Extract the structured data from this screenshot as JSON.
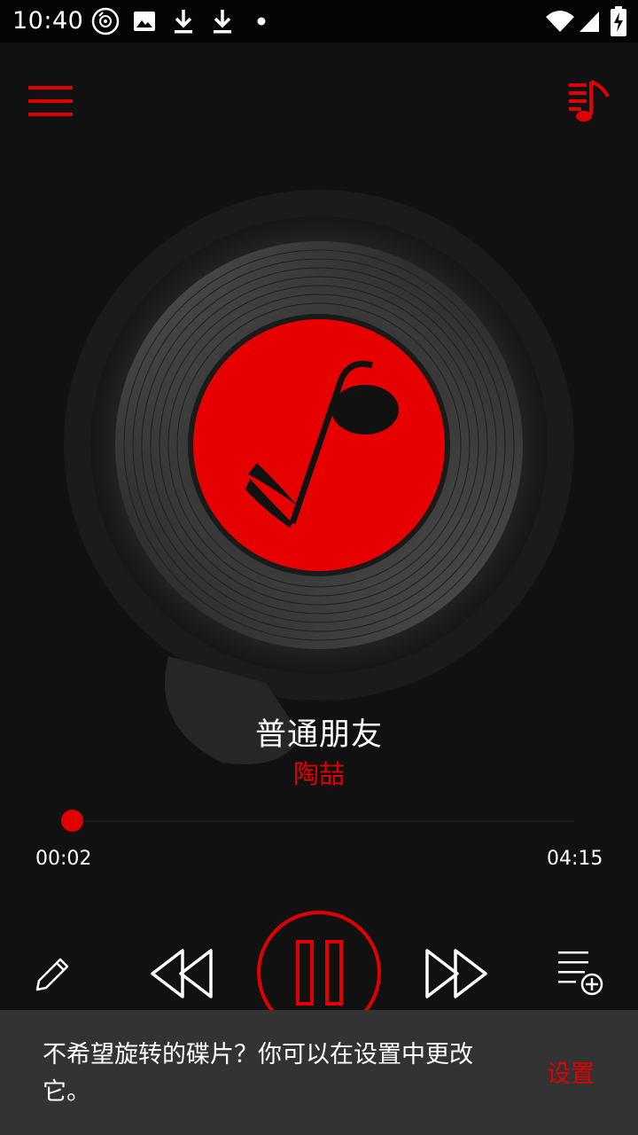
{
  "status_bar": {
    "time": "10:40",
    "left_icons": [
      "vinyl-disc-icon",
      "image-icon",
      "download-icon",
      "download-icon",
      "dot-icon"
    ],
    "right_icons": [
      "wifi-icon",
      "signal-icon",
      "battery-charging-icon"
    ]
  },
  "toolbar": {
    "menu_icon": "hamburger-menu-icon",
    "playlist_icon": "playlist-music-icon"
  },
  "now_playing": {
    "title": "普通朋友",
    "artist": "陶喆"
  },
  "progress": {
    "current_time": "00:02",
    "total_time": "04:15",
    "fraction": 0.008
  },
  "controls": {
    "edit_icon": "pencil-icon",
    "previous_icon": "rewind-icon",
    "play_pause_icon": "pause-icon",
    "next_icon": "fast-forward-icon",
    "add_to_playlist_icon": "playlist-add-icon"
  },
  "snackbar": {
    "message": "不希望旋转的碟片？你可以在设置中更改它。",
    "action": "设置"
  },
  "colors": {
    "accent": "#e00000",
    "background": "#111111",
    "snackbar": "#333333"
  }
}
